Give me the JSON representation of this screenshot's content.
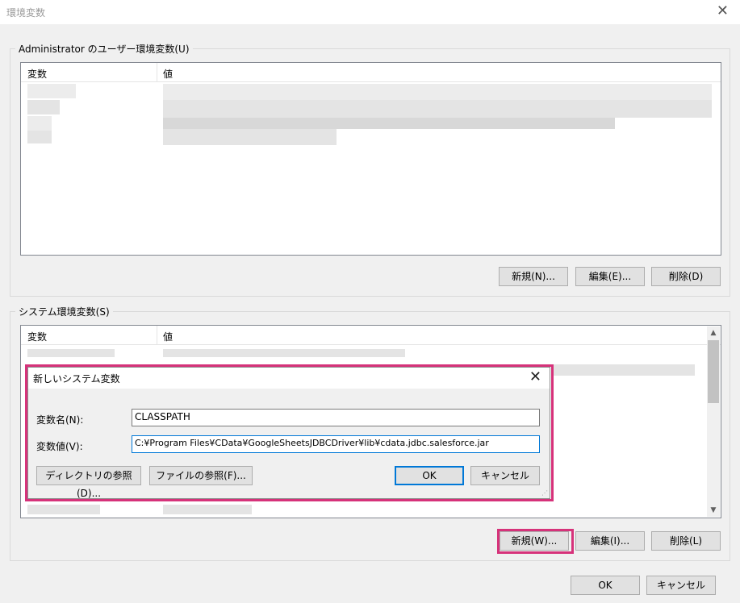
{
  "window": {
    "title": "環境変数",
    "close_glyph": "✕"
  },
  "user_section": {
    "legend": "Administrator のユーザー環境変数(U)",
    "columns": [
      "変数",
      "値"
    ],
    "buttons": {
      "new": "新規(N)...",
      "edit": "編集(E)...",
      "delete": "削除(D)"
    }
  },
  "system_section": {
    "legend": "システム環境変数(S)",
    "columns": [
      "変数",
      "値"
    ],
    "buttons": {
      "new": "新規(W)...",
      "edit": "編集(I)...",
      "delete": "削除(L)"
    },
    "scroll_up": "▲",
    "scroll_down": "▼"
  },
  "dialog": {
    "title": "新しいシステム変数",
    "close_glyph": "✕",
    "name_label": "変数名(N):",
    "name_value": "CLASSPATH",
    "value_label": "変数値(V):",
    "value_value": "C:¥Program Files¥CData¥GoogleSheetsJDBCDriver¥lib¥cdata.jdbc.salesforce.jar",
    "browse_dir": "ディレクトリの参照(D)...",
    "browse_file": "ファイルの参照(F)...",
    "ok": "OK",
    "cancel": "キャンセル",
    "grip": "⋰"
  },
  "footer": {
    "ok": "OK",
    "cancel": "キャンセル"
  },
  "colors": {
    "highlight": "#d6327a",
    "focus": "#0078d7"
  }
}
